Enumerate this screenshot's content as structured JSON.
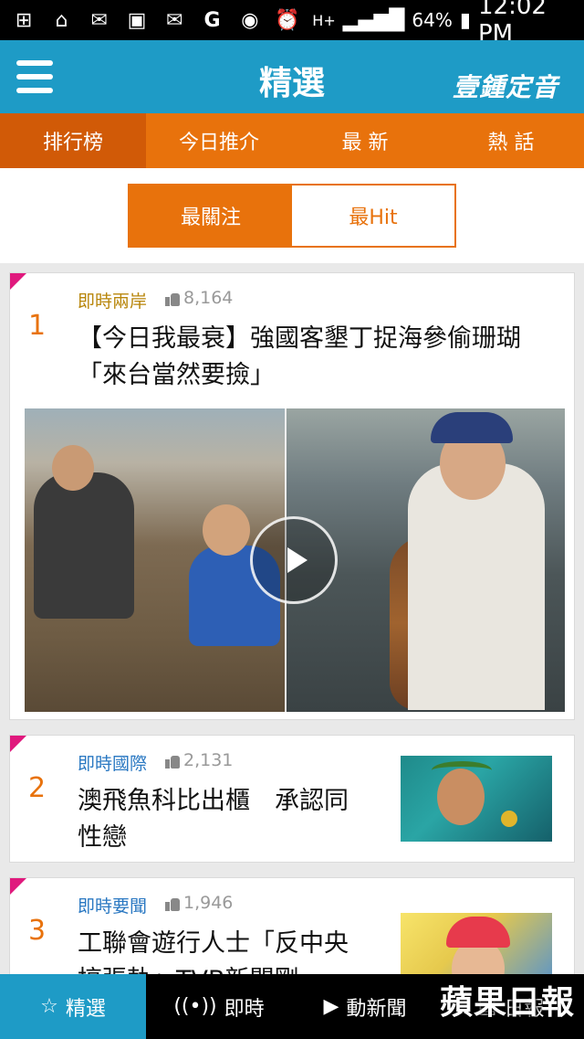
{
  "status_bar": {
    "battery": "64%",
    "time": "12:02 PM",
    "icons": [
      "plus-icon",
      "home-icon",
      "mail-icon",
      "image-icon",
      "mail-icon",
      "google-icon",
      "eye-icon",
      "alarm-icon",
      "hplus-icon",
      "signal-icon",
      "battery-icon"
    ],
    "network": "H+"
  },
  "app_bar": {
    "title": "精選",
    "logo": "壹鍾定音"
  },
  "tabs": [
    {
      "label": "排行榜",
      "active": true
    },
    {
      "label": "今日推介",
      "active": false
    },
    {
      "label": "最 新",
      "active": false
    },
    {
      "label": "熱 話",
      "active": false
    }
  ],
  "toggle": {
    "left": "最關注",
    "right": "最Hit",
    "selected": "最關注"
  },
  "articles": [
    {
      "rank": "1",
      "category": "即時兩岸",
      "category_color": "#b8860b",
      "likes": "8,164",
      "headline": "【今日我最衰】強國客墾丁捉海參偷珊瑚 「來台當然要撿」",
      "has_video": true
    },
    {
      "rank": "2",
      "category": "即時國際",
      "category_color": "#2a78c2",
      "likes": "2,131",
      "headline": "澳飛魚科比出櫃　承認同性戀"
    },
    {
      "rank": "3",
      "category": "即時要聞",
      "category_color": "#2a78c2",
      "likes": "1,946",
      "headline": "工聯會遊行人士「反中央搞張軌」TVB新聞剛"
    }
  ],
  "bottom_nav": [
    {
      "label": "精選",
      "icon": "star-icon",
      "active": true
    },
    {
      "label": "即時",
      "icon": "broadcast-icon",
      "active": false
    },
    {
      "label": "動新聞",
      "icon": "play-circle-icon",
      "active": false
    },
    {
      "label": "日報",
      "icon": "newspaper-icon",
      "active": false
    }
  ],
  "brand": "蘋果日報"
}
